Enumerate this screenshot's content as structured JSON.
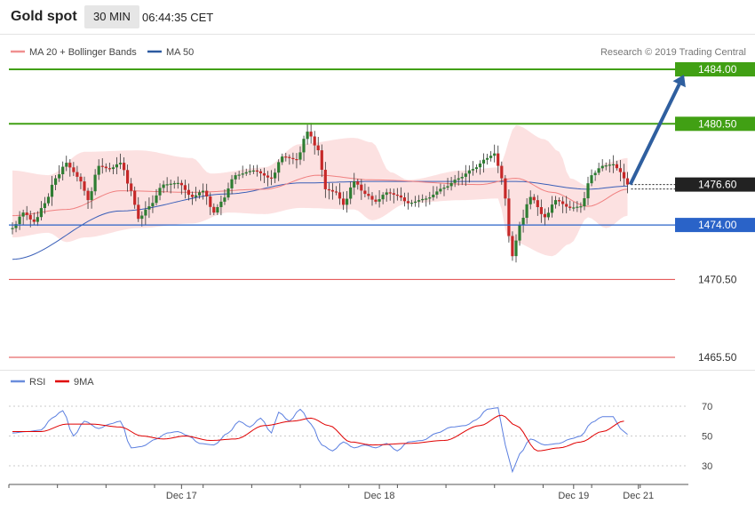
{
  "header": {
    "title": "Gold spot",
    "timeframe": "30 MIN",
    "time": "06:44:35 CET"
  },
  "legend": {
    "ma_bb": "MA 20 + Bollinger Bands",
    "ma50": "MA 50",
    "credit": "Research © 2019 Trading Central"
  },
  "rsi_legend": {
    "rsi": "RSI",
    "ma": "9MA"
  },
  "colors": {
    "green": "#41a014",
    "blue": "#2a63c8",
    "red": "#e24444",
    "pink": "#f4a0a0",
    "candle_green": "#2e7d32",
    "candle_red": "#c62828",
    "arrow": "#2f5f9f"
  },
  "chart_data": [
    {
      "type": "candlestick",
      "title": "Gold spot",
      "ylim": [
        1465.0,
        1485.0
      ],
      "levels": [
        {
          "value": 1484.0,
          "label": "1484.00",
          "kind": "target"
        },
        {
          "value": 1480.5,
          "label": "1480.50",
          "kind": "resistance"
        },
        {
          "value": 1476.6,
          "label": "1476.60",
          "kind": "last"
        },
        {
          "value": 1474.0,
          "label": "1474.00",
          "kind": "pivot"
        },
        {
          "value": 1470.5,
          "label": "1470.50",
          "kind": "support"
        },
        {
          "value": 1465.5,
          "label": "1465.50",
          "kind": "support"
        }
      ],
      "close_points": [
        [
          0,
          1473.8
        ],
        [
          3,
          1474.8
        ],
        [
          6,
          1474.2
        ],
        [
          9,
          1475.4
        ],
        [
          12,
          1477.0
        ],
        [
          15,
          1478.0
        ],
        [
          17,
          1477.4
        ],
        [
          19,
          1476.8
        ],
        [
          21,
          1475.6
        ],
        [
          24,
          1477.8
        ],
        [
          27,
          1477.6
        ],
        [
          30,
          1478.0
        ],
        [
          33,
          1476.2
        ],
        [
          35,
          1474.4
        ],
        [
          38,
          1475.2
        ],
        [
          42,
          1476.6
        ],
        [
          46,
          1476.7
        ],
        [
          50,
          1475.8
        ],
        [
          53,
          1476.2
        ],
        [
          56,
          1474.8
        ],
        [
          58,
          1475.5
        ],
        [
          62,
          1477.2
        ],
        [
          67,
          1477.5
        ],
        [
          72,
          1477.0
        ],
        [
          75,
          1478.4
        ],
        [
          79,
          1478.2
        ],
        [
          82,
          1480.0
        ],
        [
          85,
          1478.8
        ],
        [
          87,
          1476.3
        ],
        [
          90,
          1476.1
        ],
        [
          92,
          1475.3
        ],
        [
          95,
          1476.8
        ],
        [
          98,
          1476.0
        ],
        [
          101,
          1475.5
        ],
        [
          104,
          1476.1
        ],
        [
          107,
          1475.9
        ],
        [
          110,
          1475.4
        ],
        [
          115,
          1475.7
        ],
        [
          120,
          1476.4
        ],
        [
          124,
          1477.0
        ],
        [
          128,
          1477.6
        ],
        [
          132,
          1478.3
        ],
        [
          134,
          1478.6
        ],
        [
          136,
          1477.0
        ],
        [
          139,
          1472.0
        ],
        [
          141,
          1474.0
        ],
        [
          144,
          1475.8
        ],
        [
          148,
          1474.5
        ],
        [
          151,
          1475.6
        ],
        [
          155,
          1475.1
        ],
        [
          158,
          1475.2
        ],
        [
          161,
          1477.2
        ],
        [
          164,
          1477.8
        ],
        [
          167,
          1477.9
        ],
        [
          169,
          1477.4
        ],
        [
          171,
          1476.6
        ]
      ],
      "ma50_points": [
        [
          0,
          1471.8
        ],
        [
          30,
          1474.9
        ],
        [
          60,
          1476.0
        ],
        [
          80,
          1476.7
        ],
        [
          100,
          1476.8
        ],
        [
          140,
          1476.8
        ],
        [
          160,
          1476.3
        ],
        [
          171,
          1476.5
        ]
      ],
      "ma20_points": [
        [
          0,
          1474.6
        ],
        [
          15,
          1475.0
        ],
        [
          30,
          1476.2
        ],
        [
          50,
          1476.1
        ],
        [
          70,
          1476.3
        ],
        [
          85,
          1477.2
        ],
        [
          100,
          1476.9
        ],
        [
          130,
          1476.6
        ],
        [
          140,
          1477.0
        ],
        [
          150,
          1476.1
        ],
        [
          160,
          1475.2
        ],
        [
          171,
          1476.3
        ]
      ],
      "bb_upper_points": [
        [
          0,
          1477.5
        ],
        [
          10,
          1477.2
        ],
        [
          20,
          1478.7
        ],
        [
          35,
          1478.8
        ],
        [
          50,
          1478.3
        ],
        [
          55,
          1477.3
        ],
        [
          70,
          1477.7
        ],
        [
          80,
          1479.2
        ],
        [
          95,
          1479.6
        ],
        [
          100,
          1479.3
        ],
        [
          105,
          1477.4
        ],
        [
          110,
          1476.9
        ],
        [
          125,
          1477.5
        ],
        [
          135,
          1477.7
        ],
        [
          140,
          1480.4
        ],
        [
          148,
          1479.5
        ],
        [
          152,
          1478.7
        ],
        [
          155,
          1477.0
        ],
        [
          160,
          1476.5
        ],
        [
          165,
          1478.0
        ],
        [
          171,
          1478.3
        ]
      ],
      "bb_lower_points": [
        [
          0,
          1473.2
        ],
        [
          10,
          1473.5
        ],
        [
          15,
          1472.9
        ],
        [
          20,
          1473.2
        ],
        [
          35,
          1473.8
        ],
        [
          50,
          1474.1
        ],
        [
          60,
          1474.8
        ],
        [
          70,
          1474.7
        ],
        [
          80,
          1475.1
        ],
        [
          95,
          1475.0
        ],
        [
          100,
          1474.3
        ],
        [
          110,
          1475.4
        ],
        [
          125,
          1475.6
        ],
        [
          135,
          1475.7
        ],
        [
          138,
          1473.0
        ],
        [
          150,
          1472.0
        ],
        [
          155,
          1472.8
        ],
        [
          160,
          1474.5
        ],
        [
          165,
          1473.8
        ],
        [
          171,
          1474.6
        ]
      ],
      "forecast": {
        "from_index": 171,
        "from_value": 1476.6,
        "to_value": 1484.0
      },
      "x_labels": [
        {
          "index": 47,
          "label": "Dec 17"
        },
        {
          "index": 102,
          "label": "Dec 18"
        },
        {
          "index": 156,
          "label": "Dec 19"
        },
        {
          "index": 174,
          "label": "Dec 21"
        }
      ],
      "series": [
        {
          "name": "MA 20 + Bollinger Bands"
        },
        {
          "name": "MA 50"
        }
      ]
    },
    {
      "type": "line",
      "ylim": [
        20,
        78
      ],
      "yticks": [
        30,
        50,
        70
      ],
      "rsi_points": [
        [
          0,
          52
        ],
        [
          4,
          53
        ],
        [
          8,
          54
        ],
        [
          11,
          62
        ],
        [
          14,
          67
        ],
        [
          17,
          50
        ],
        [
          20,
          60
        ],
        [
          24,
          55
        ],
        [
          27,
          58
        ],
        [
          30,
          60
        ],
        [
          33,
          42
        ],
        [
          36,
          43
        ],
        [
          40,
          48
        ],
        [
          43,
          52
        ],
        [
          46,
          53
        ],
        [
          49,
          50
        ],
        [
          52,
          45
        ],
        [
          56,
          44
        ],
        [
          60,
          52
        ],
        [
          63,
          60
        ],
        [
          66,
          56
        ],
        [
          69,
          62
        ],
        [
          72,
          52
        ],
        [
          74,
          66
        ],
        [
          77,
          60
        ],
        [
          80,
          68
        ],
        [
          83,
          58
        ],
        [
          86,
          44
        ],
        [
          89,
          40
        ],
        [
          92,
          46
        ],
        [
          95,
          42
        ],
        [
          98,
          44
        ],
        [
          101,
          42
        ],
        [
          104,
          45
        ],
        [
          107,
          40
        ],
        [
          110,
          46
        ],
        [
          114,
          47
        ],
        [
          118,
          52
        ],
        [
          122,
          56
        ],
        [
          126,
          57
        ],
        [
          129,
          61
        ],
        [
          132,
          68
        ],
        [
          135,
          69
        ],
        [
          137,
          44
        ],
        [
          139,
          26
        ],
        [
          141,
          38
        ],
        [
          144,
          48
        ],
        [
          148,
          44
        ],
        [
          152,
          45
        ],
        [
          155,
          48
        ],
        [
          158,
          50
        ],
        [
          161,
          59
        ],
        [
          164,
          63
        ],
        [
          167,
          63
        ],
        [
          169,
          55
        ],
        [
          171,
          51
        ]
      ],
      "ma_points": [
        [
          0,
          53
        ],
        [
          8,
          53
        ],
        [
          15,
          58
        ],
        [
          22,
          58
        ],
        [
          30,
          56
        ],
        [
          36,
          50
        ],
        [
          42,
          48
        ],
        [
          48,
          50
        ],
        [
          55,
          47
        ],
        [
          62,
          48
        ],
        [
          70,
          57
        ],
        [
          78,
          60
        ],
        [
          83,
          62
        ],
        [
          88,
          57
        ],
        [
          94,
          46
        ],
        [
          100,
          44
        ],
        [
          110,
          45
        ],
        [
          120,
          47
        ],
        [
          130,
          57
        ],
        [
          136,
          64
        ],
        [
          140,
          57
        ],
        [
          146,
          40
        ],
        [
          152,
          42
        ],
        [
          158,
          46
        ],
        [
          164,
          53
        ],
        [
          170,
          60
        ]
      ],
      "x_labels": [
        {
          "index": 47,
          "label": "Dec 17"
        },
        {
          "index": 102,
          "label": "Dec 18"
        },
        {
          "index": 156,
          "label": "Dec 19"
        },
        {
          "index": 174,
          "label": "Dec 21"
        }
      ],
      "series": [
        {
          "name": "RSI"
        },
        {
          "name": "9MA"
        }
      ]
    }
  ]
}
